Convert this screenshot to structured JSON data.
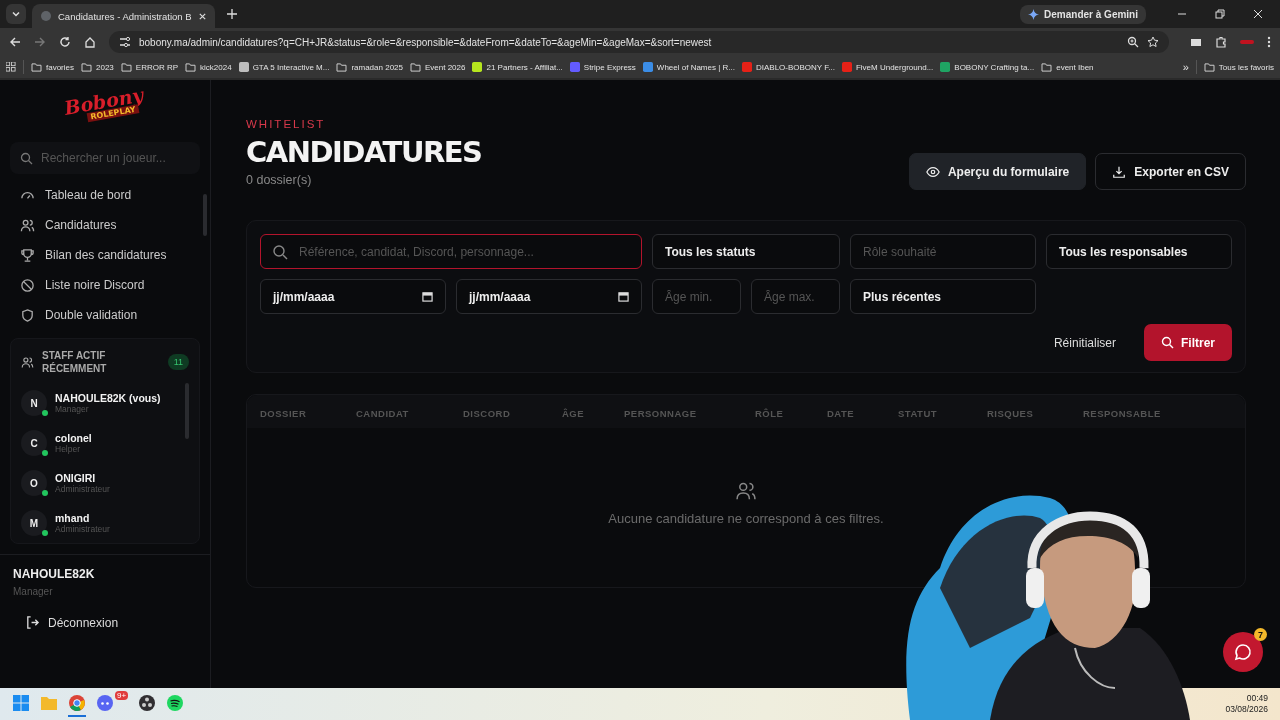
{
  "browser": {
    "tabs": [
      {
        "title": "Candidatures - Administration B",
        "selected": true
      }
    ],
    "address": "bobony.ma/admin/candidatures?q=CH+JR&status=&role=&responsible=&dateFrom=&dateTo=&ageMin=&ageMax=&sort=newest",
    "gemini": "Demander à Gemini",
    "bookmarks": [
      {
        "label": "favories",
        "kind": "folder"
      },
      {
        "label": "2023",
        "kind": "folder"
      },
      {
        "label": "ERROR RP",
        "kind": "folder"
      },
      {
        "label": "kick2024",
        "kind": "folder"
      },
      {
        "label": "GTA 5 Interactive M...",
        "kind": "site",
        "color": "#bdbdbd"
      },
      {
        "label": "ramadan 2025",
        "kind": "folder"
      },
      {
        "label": "Event 2026",
        "kind": "folder"
      },
      {
        "label": "21 Partners - Affiliat...",
        "kind": "site",
        "color": "#b6e61e"
      },
      {
        "label": "Stripe Express",
        "kind": "site",
        "color": "#635bff"
      },
      {
        "label": "Wheel of Names | R...",
        "kind": "site",
        "color": "#3b8de6"
      },
      {
        "label": "DIABLO-BOBONY F...",
        "kind": "site",
        "color": "#e62117"
      },
      {
        "label": "FiveM Underground...",
        "kind": "site",
        "color": "#e62117"
      },
      {
        "label": "BOBONY Crafting ta...",
        "kind": "site",
        "color": "#1fa463"
      },
      {
        "label": "event Iben",
        "kind": "folder"
      }
    ],
    "more": "»",
    "all_bookmarks": "Tous les favoris"
  },
  "sidebar": {
    "logo": {
      "top": "Bobony",
      "bottom": "ROLEPLAY"
    },
    "search": {
      "placeholder": "Rechercher un joueur..."
    },
    "nav": [
      {
        "label": "Tableau de bord"
      },
      {
        "label": "Candidatures"
      },
      {
        "label": "Bilan des candidatures"
      },
      {
        "label": "Liste noire Discord"
      },
      {
        "label": "Double validation"
      }
    ],
    "staff": {
      "title": "STAFF ACTIF RÉCEMMENT",
      "count": "11",
      "members": [
        {
          "initial": "N",
          "name": "NAHOULE82K (vous)",
          "role": "Manager",
          "online": true
        },
        {
          "initial": "C",
          "name": "colonel",
          "role": "Helper",
          "online": true
        },
        {
          "initial": "O",
          "name": "ONIGIRI",
          "role": "Administrateur",
          "online": true
        },
        {
          "initial": "M",
          "name": "mhand",
          "role": "Administrateur",
          "online": true
        }
      ]
    },
    "user": {
      "name": "NAHOULE82K",
      "role": "Manager"
    },
    "logout": "Déconnexion"
  },
  "header": {
    "eyebrow": "WHITELIST",
    "title": "CANDIDATURES",
    "count": "0 dossier(s)",
    "buttons": [
      {
        "label": "Aperçu du formulaire",
        "kind": "preview"
      },
      {
        "label": "Exporter en CSV",
        "kind": "export"
      }
    ]
  },
  "filters": [
    {
      "kind": "search",
      "placeholder": "Référence, candidat, Discord, personnage...",
      "focused": true
    },
    {
      "kind": "select",
      "value": "Tous les statuts"
    },
    {
      "kind": "text",
      "placeholder": "Rôle souhaité"
    },
    {
      "kind": "select",
      "value": "Tous les responsables"
    },
    {
      "kind": "date",
      "value": "jj/mm/aaaa"
    },
    {
      "kind": "date",
      "value": "jj/mm/aaaa"
    },
    {
      "kind": "number",
      "placeholder": "Âge min."
    },
    {
      "kind": "number",
      "placeholder": "Âge max."
    },
    {
      "kind": "select",
      "value": "Plus récentes"
    }
  ],
  "actions": {
    "reset": "Réinitialiser",
    "filter": "Filtrer"
  },
  "table": {
    "columns": [
      "DOSSIER",
      "CANDIDAT",
      "DISCORD",
      "ÂGE",
      "PERSONNAGE",
      "RÔLE",
      "DATE",
      "STATUT",
      "RISQUES",
      "RESPONSABLE"
    ],
    "empty": "Aucune candidature ne correspond à ces filtres."
  },
  "chat": {
    "badge": "7"
  },
  "taskbar": {
    "apps": [
      {
        "kind": "start"
      },
      {
        "kind": "explorer"
      },
      {
        "kind": "chrome",
        "selected": true
      },
      {
        "kind": "discord",
        "badge": "9+"
      },
      {
        "kind": "obs"
      },
      {
        "kind": "spotify"
      }
    ],
    "time": "00:49",
    "date": "03/08/2026"
  }
}
